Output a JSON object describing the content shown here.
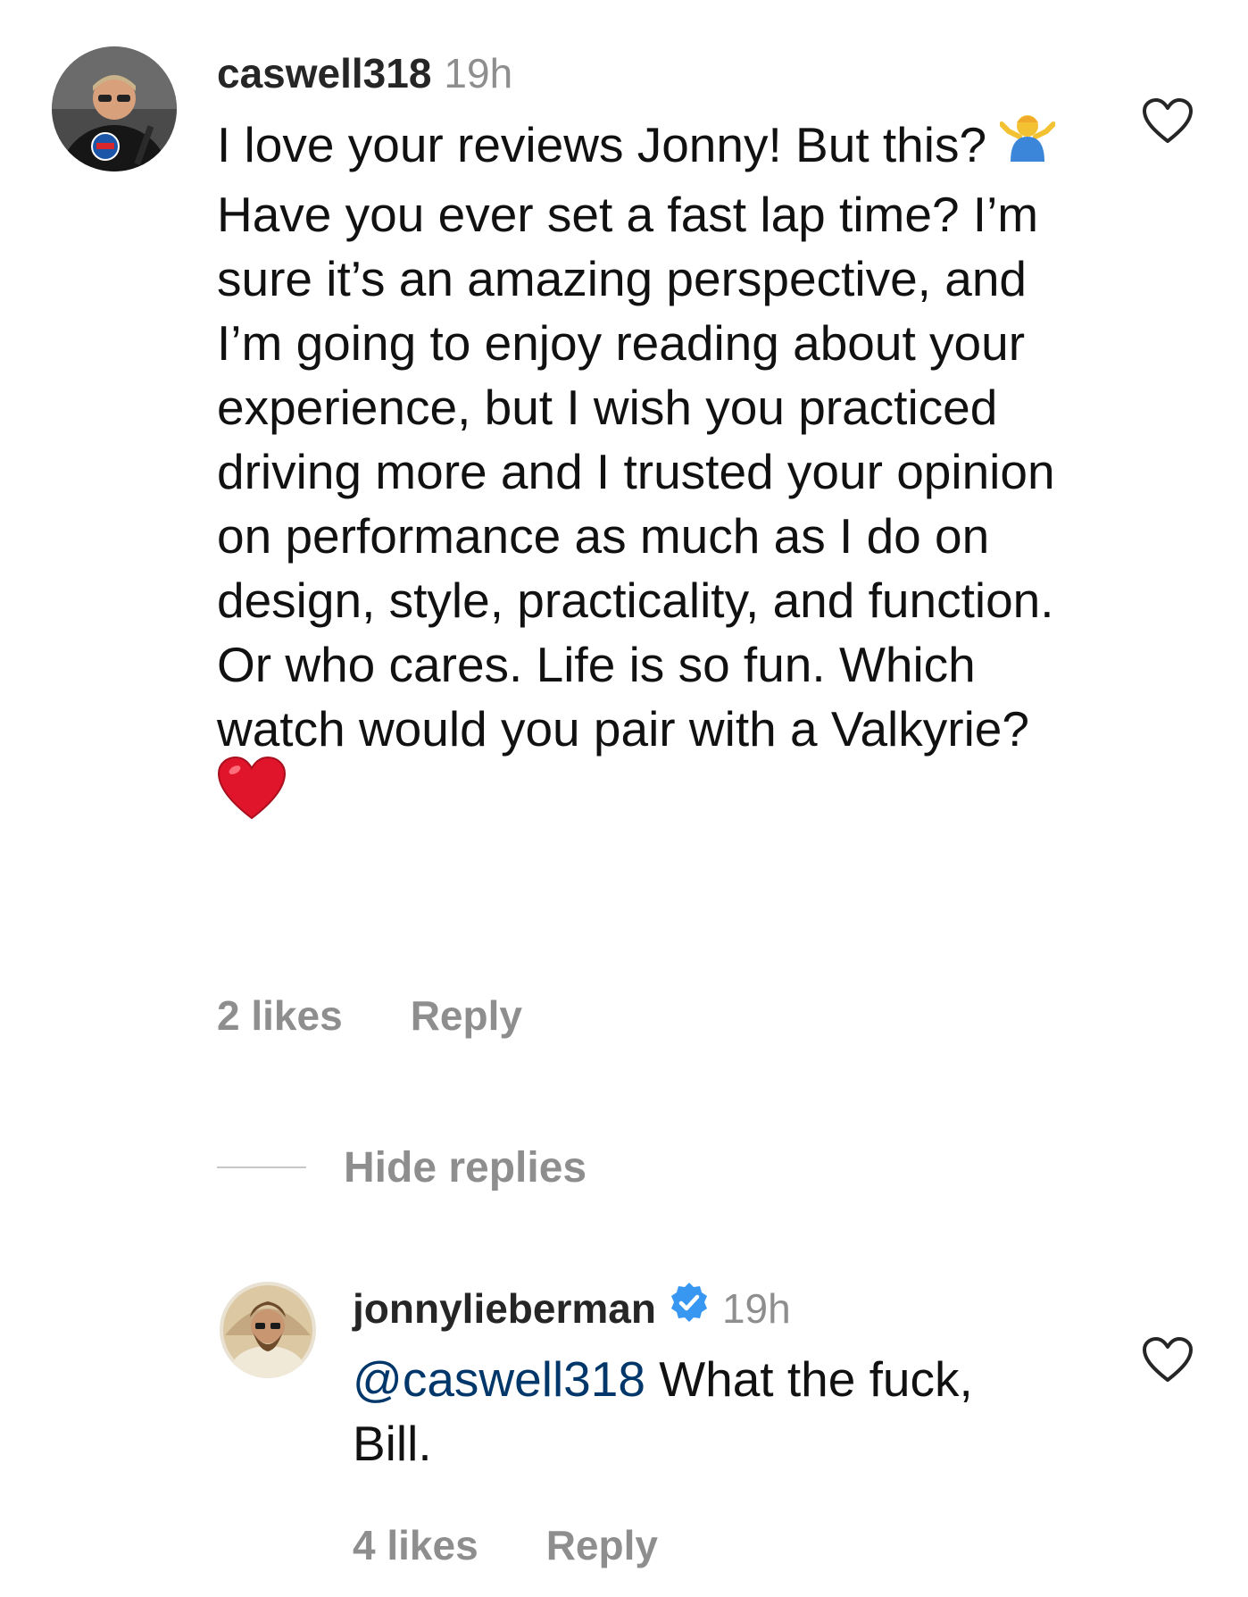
{
  "comments": [
    {
      "username": "caswell318",
      "time": "19h",
      "text_part1": "I love your reviews Jonny! But this?",
      "emoji1": "person-shrugging-emoji",
      "text_part2": "Have you ever set a fast lap time? I’m sure it’s an amazing perspective, and I’m going to enjoy reading about your experience, but I wish you practiced driving more and I trusted your opinion on performance as much as I do on design, style, practicality, and function. Or who cares. Life is so fun. Which watch would you pair with a Valkyrie?",
      "emoji2": "red-heart-emoji",
      "likes": "2 likes",
      "reply_label": "Reply"
    }
  ],
  "hide_replies_label": "Hide replies",
  "replies": [
    {
      "username": "jonnylieberman",
      "verified": true,
      "time": "19h",
      "mention": "@caswell318",
      "text": "What the fuck, Bill.",
      "likes": "4 likes",
      "reply_label": "Reply"
    }
  ],
  "icons": {
    "like": "heart-outline-icon",
    "verified": "verified-badge-icon"
  },
  "colors": {
    "username": "#262626",
    "secondary": "#8e8e8e",
    "mention": "#00376b",
    "verified": "#3897f0",
    "heart_emoji": "#e0142a"
  }
}
